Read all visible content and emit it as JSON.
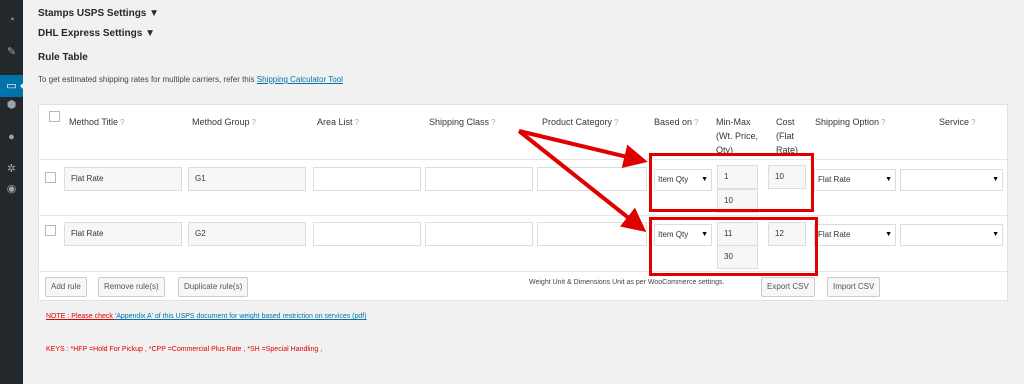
{
  "sidebar": {
    "icons": [
      "dashboard-icon",
      "pin-icon",
      "chat-icon",
      "package-icon",
      "users-icon",
      "settings-icon",
      "play-icon"
    ]
  },
  "sections": {
    "stamps": "Stamps USPS Settings ▼",
    "dhl": "DHL Express Settings ▼",
    "rule_table": "Rule Table"
  },
  "intro": {
    "text": "To get estimated shipping rates for multiple carriers, refer this ",
    "link": "Shipping Calculator Tool"
  },
  "table": {
    "headers": {
      "method_title": "Method Title",
      "method_group": "Method Group",
      "area_list": "Area List",
      "shipping_class": "Shipping Class",
      "product_category": "Product Category",
      "based_on": "Based on",
      "min_max_1": "Min-Max",
      "min_max_2": "(Wt. Price,",
      "min_max_3": "Qty)",
      "cost_1": "Cost",
      "cost_2": "(Flat",
      "cost_3": "Rate)",
      "shipping_option": "Shipping Option",
      "service": "Service"
    },
    "help_glyph": "?",
    "rows": [
      {
        "method_title": "Flat Rate",
        "method_group": "G1",
        "area_list": "",
        "shipping_class": "",
        "product_category": "",
        "based_on": "Item Qty",
        "min": "1",
        "max": "10",
        "cost": "10",
        "shipping_option": "Flat Rate",
        "service": ""
      },
      {
        "method_title": "Flat Rate",
        "method_group": "G2",
        "area_list": "",
        "shipping_class": "",
        "product_category": "",
        "based_on": "Item Qty",
        "min": "11",
        "max": "30",
        "cost": "12",
        "shipping_option": "Flat Rate",
        "service": ""
      }
    ],
    "buttons": {
      "add": "Add rule",
      "remove": "Remove rule(s)",
      "duplicate": "Duplicate rule(s)",
      "export": "Export CSV",
      "import": "Import CSV"
    },
    "weight_note": "Weight Unit & Dimensions Unit as per WooCommerce settings."
  },
  "notes": {
    "note_label": "NOTE : Please check ",
    "note_link": "'Appendix A' of this USPS document for weight based restriction on services (pdf)",
    "keys": "KEYS : *HFP =Hold For Pickup , *CPP =Commercial Plus Rate , *SH =Special Handling ,"
  },
  "colors": {
    "annotation": "#e00000",
    "sidebar_bg": "#23282d",
    "sidebar_active": "#0073aa",
    "link": "#0073aa"
  }
}
